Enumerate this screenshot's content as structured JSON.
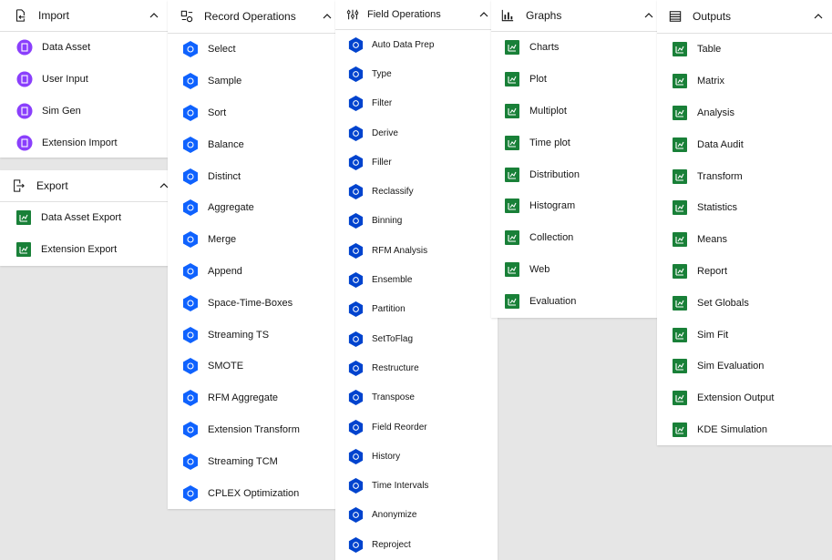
{
  "colors": {
    "import": "#8a3ffc",
    "export": "#198038",
    "record": "#0f62fe",
    "field": "#0043ce",
    "graph": "#198038",
    "output": "#198038"
  },
  "import": {
    "title": "Import",
    "icon": "import-icon",
    "items": [
      {
        "label": "Data Asset",
        "icon": "data-asset-icon"
      },
      {
        "label": "User Input",
        "icon": "user-input-icon"
      },
      {
        "label": "Sim Gen",
        "icon": "sim-gen-icon"
      },
      {
        "label": "Extension Import",
        "icon": "extension-import-icon"
      }
    ]
  },
  "export": {
    "title": "Export",
    "icon": "export-icon",
    "items": [
      {
        "label": "Data Asset Export",
        "icon": "data-asset-export-icon"
      },
      {
        "label": "Extension Export",
        "icon": "extension-export-icon"
      }
    ]
  },
  "record": {
    "title": "Record Operations",
    "icon": "record-operations-icon",
    "items": [
      {
        "label": "Select"
      },
      {
        "label": "Sample"
      },
      {
        "label": "Sort"
      },
      {
        "label": "Balance"
      },
      {
        "label": "Distinct"
      },
      {
        "label": "Aggregate"
      },
      {
        "label": "Merge"
      },
      {
        "label": "Append"
      },
      {
        "label": "Space-Time-Boxes"
      },
      {
        "label": "Streaming TS"
      },
      {
        "label": "SMOTE"
      },
      {
        "label": "RFM Aggregate"
      },
      {
        "label": "Extension Transform"
      },
      {
        "label": "Streaming TCM"
      },
      {
        "label": "CPLEX Optimization"
      }
    ]
  },
  "field": {
    "title": "Field Operations",
    "icon": "field-operations-icon",
    "items": [
      {
        "label": "Auto Data Prep"
      },
      {
        "label": "Type"
      },
      {
        "label": "Filter"
      },
      {
        "label": "Derive"
      },
      {
        "label": "Filler"
      },
      {
        "label": "Reclassify"
      },
      {
        "label": "Binning"
      },
      {
        "label": "RFM Analysis"
      },
      {
        "label": "Ensemble"
      },
      {
        "label": "Partition"
      },
      {
        "label": "SetToFlag"
      },
      {
        "label": "Restructure"
      },
      {
        "label": "Transpose"
      },
      {
        "label": "Field Reorder"
      },
      {
        "label": "History"
      },
      {
        "label": "Time Intervals"
      },
      {
        "label": "Anonymize"
      },
      {
        "label": "Reproject"
      }
    ]
  },
  "graphs": {
    "title": "Graphs",
    "icon": "graphs-icon",
    "items": [
      {
        "label": "Charts"
      },
      {
        "label": "Plot"
      },
      {
        "label": "Multiplot"
      },
      {
        "label": "Time plot"
      },
      {
        "label": "Distribution"
      },
      {
        "label": "Histogram"
      },
      {
        "label": "Collection"
      },
      {
        "label": "Web"
      },
      {
        "label": "Evaluation"
      }
    ]
  },
  "outputs": {
    "title": "Outputs",
    "icon": "outputs-icon",
    "items": [
      {
        "label": "Table"
      },
      {
        "label": "Matrix"
      },
      {
        "label": "Analysis"
      },
      {
        "label": "Data Audit"
      },
      {
        "label": "Transform"
      },
      {
        "label": "Statistics"
      },
      {
        "label": "Means"
      },
      {
        "label": "Report"
      },
      {
        "label": "Set Globals"
      },
      {
        "label": "Sim Fit"
      },
      {
        "label": "Sim Evaluation"
      },
      {
        "label": "Extension Output"
      },
      {
        "label": "KDE Simulation"
      }
    ]
  }
}
